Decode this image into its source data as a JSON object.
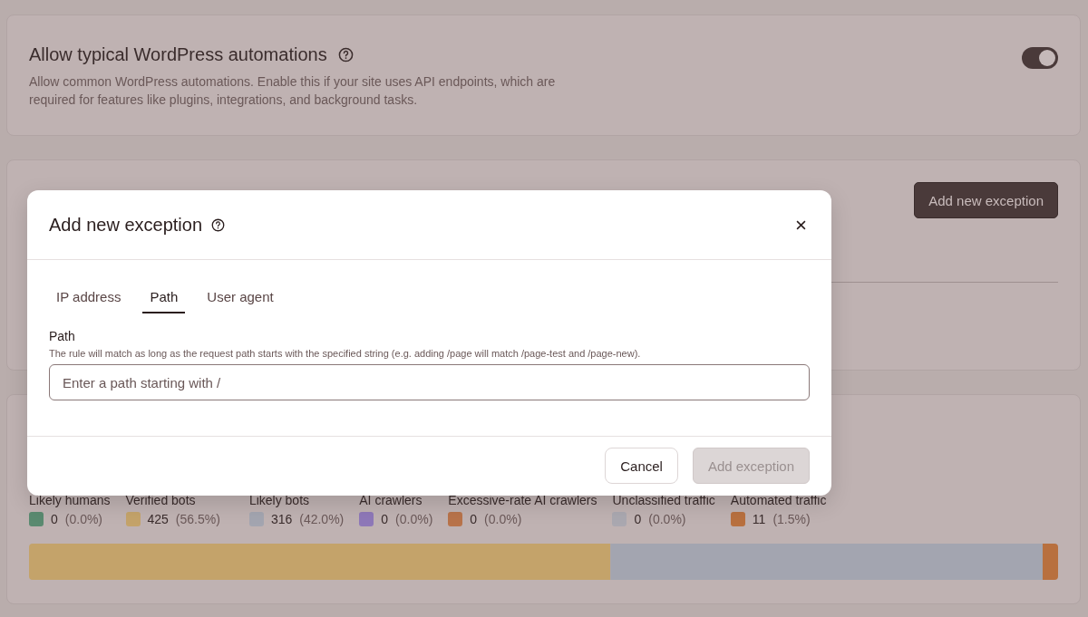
{
  "automations": {
    "title": "Allow typical WordPress automations",
    "description": "Allow common WordPress automations. Enable this if your site uses API endpoints, which are required for features like plugins, integrations, and background tasks.",
    "on": true
  },
  "exceptions": {
    "button": "Add new exception"
  },
  "traffic": {
    "categories": [
      {
        "label": "Likely humans",
        "count": "0",
        "percent": "(0.0%)",
        "color": "#5a8a70"
      },
      {
        "label": "Verified bots",
        "count": "425",
        "percent": "(56.5%)",
        "color": "#c4a36a"
      },
      {
        "label": "Likely bots",
        "count": "316",
        "percent": "(42.0%)",
        "color": "#a3a5b0"
      },
      {
        "label": "AI crawlers",
        "count": "0",
        "percent": "(0.0%)",
        "color": "#8e78b8"
      },
      {
        "label": "Excessive-rate AI crawlers",
        "count": "0",
        "percent": "(0.0%)",
        "color": "#b8734a"
      },
      {
        "label": "Unclassified traffic",
        "count": "0",
        "percent": "(0.0%)",
        "color": "#aaa8b0"
      },
      {
        "label": "Automated traffic",
        "count": "11",
        "percent": "(1.5%)",
        "color": "#b8703f"
      }
    ]
  },
  "modal": {
    "title": "Add new exception",
    "tabs": [
      {
        "label": "IP address",
        "selected": false
      },
      {
        "label": "Path",
        "selected": true
      },
      {
        "label": "User agent",
        "selected": false
      }
    ],
    "field_label": "Path",
    "hint": "The rule will match as long as the request path starts with the specified string (e.g. adding /page will match /page-test and /page-new).",
    "placeholder": "Enter a path starting with /",
    "cancel": "Cancel",
    "submit": {
      "label": "Add exception",
      "disabled": true
    }
  }
}
